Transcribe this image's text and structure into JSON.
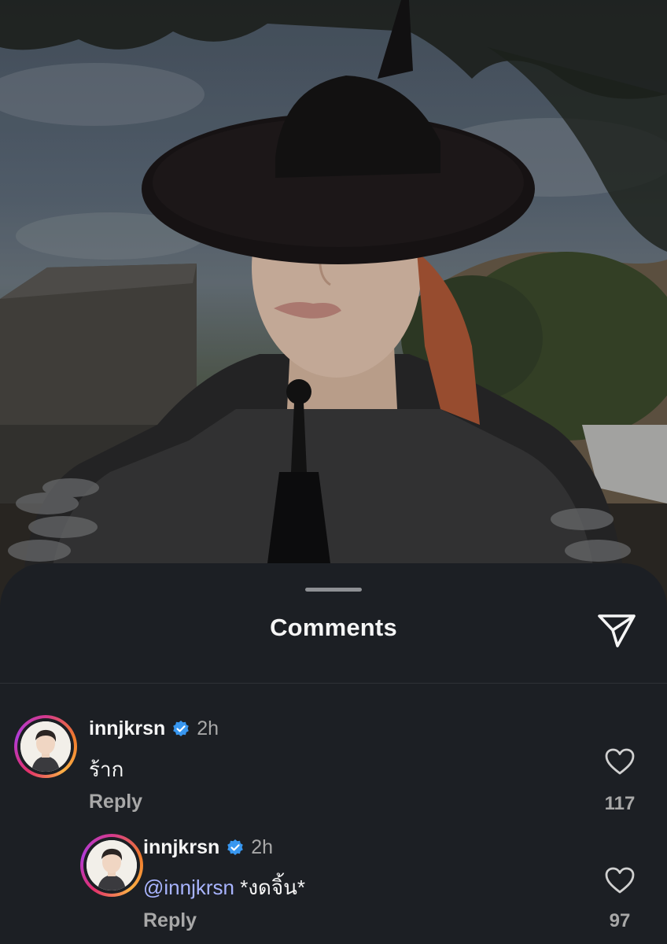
{
  "sheet": {
    "title": "Comments"
  },
  "comments": [
    {
      "username": "innjkrsn",
      "time": "2h",
      "text": "ร้าก",
      "reply_label": "Reply",
      "likes": "117"
    },
    {
      "username": "innjkrsn",
      "time": "2h",
      "mention": "@innjkrsn",
      "text": "*งดจิ้น*",
      "reply_label": "Reply",
      "likes": "97"
    }
  ],
  "icons": {
    "share": "paper-plane-icon",
    "like": "heart-outline-icon",
    "verified": "verified-badge-icon"
  },
  "colors": {
    "sheet_bg": "#1c1f24",
    "text_primary": "#f5f5f5",
    "text_secondary": "#a8a8a8",
    "mention": "#a8b4ff",
    "verified": "#3897f0"
  }
}
